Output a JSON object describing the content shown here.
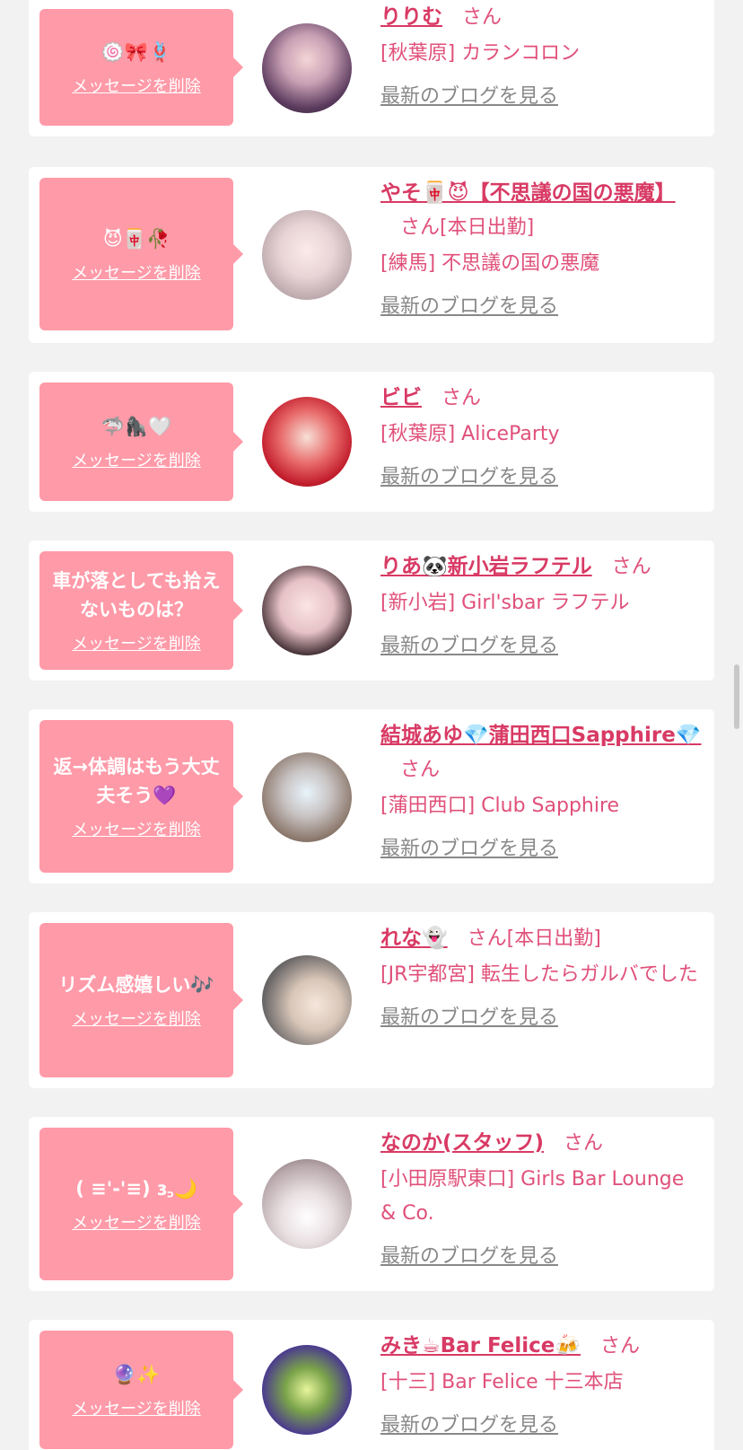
{
  "common": {
    "delete_label": "メッセージを削除",
    "blog_label": "最新のブログを見る",
    "san_label": "さん"
  },
  "items": [
    {
      "bubble": "🍥🎀🪢",
      "name": "りりむ",
      "attend": "",
      "shop": "[秋葉原] カランコロン"
    },
    {
      "bubble": "😈🀄🥀",
      "name": "やそ🀄😈【不思議の国の悪魔】",
      "attend": "[本日出勤]",
      "shop": "[練馬] 不思議の国の悪魔"
    },
    {
      "bubble": "🦈🦍🤍",
      "name": "ビビ",
      "attend": "",
      "shop": "[秋葉原] AliceParty"
    },
    {
      "bubble": "車が落としても拾えないものは？",
      "name": "りあ🐼新小岩ラフテル",
      "attend": "",
      "shop": "[新小岩] Girl'sbar ラフテル"
    },
    {
      "bubble": "返→体調はもう大丈夫そう💜",
      "name": "結城あゆ💎蒲田西口Sapphire💎",
      "attend": "",
      "shop": "[蒲田西口] Club Sapphire"
    },
    {
      "bubble": "リズム感嬉しい🎶",
      "name": "れな👻",
      "attend": "[本日出勤]",
      "shop": "[JR宇都宮] 転生したらガルバでした"
    },
    {
      "bubble": "( ≡'-'≡) ɜ꜆🌙",
      "name": "なのか(スタッフ)",
      "attend": "",
      "shop": "[小田原駅東口] Girls Bar Lounge & Co."
    },
    {
      "bubble": "🔮✨",
      "name": "みき☕Bar Felice🍻",
      "attend": "",
      "shop": "[十三] Bar Felice 十三本店"
    }
  ]
}
